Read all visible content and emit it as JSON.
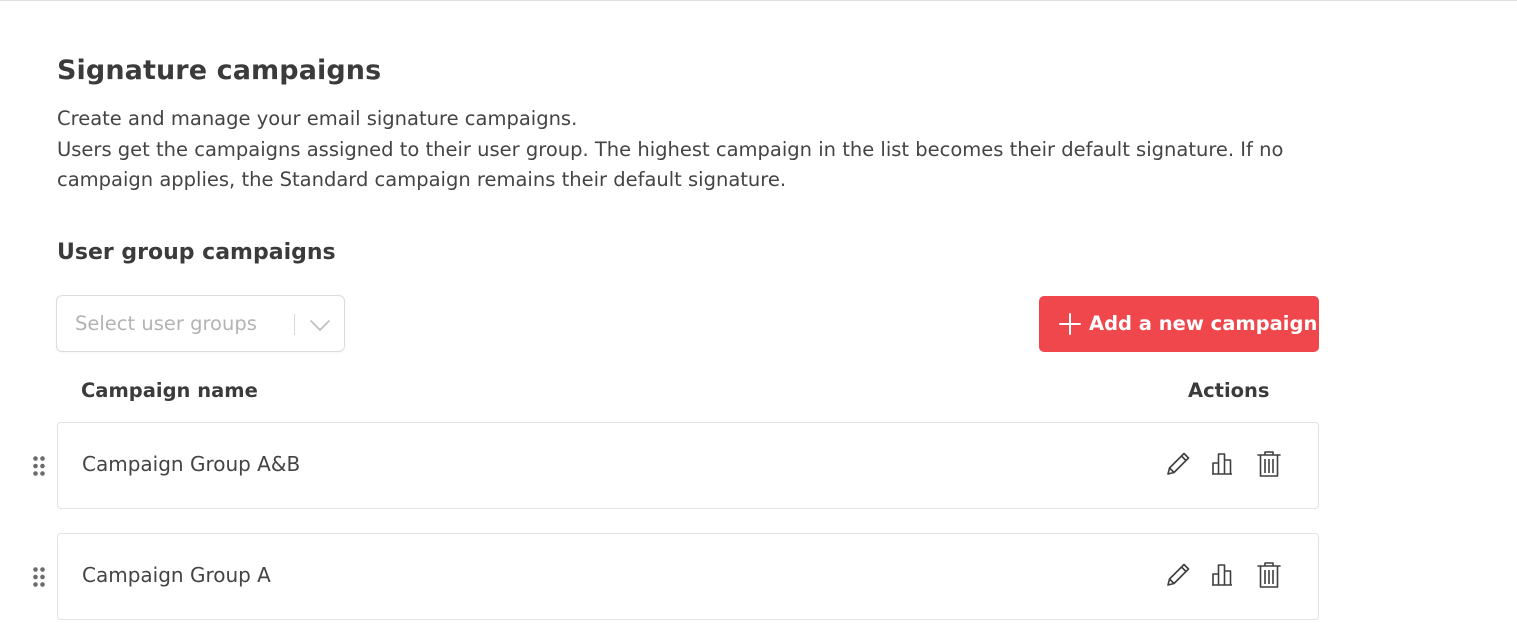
{
  "page": {
    "title": "Signature campaigns",
    "description_lines": [
      "Create and manage your email signature campaigns.",
      "Users get the campaigns assigned to their user group. The highest campaign in the list becomes their default signature. If no campaign applies, the Standard campaign remains their default signature."
    ]
  },
  "section": {
    "title": "User group campaigns"
  },
  "filter": {
    "placeholder": "Select user groups",
    "icon": "chevron-down-icon"
  },
  "add_button": {
    "label": "Add a new campaign",
    "icon": "plus-icon",
    "color": "#f0474d"
  },
  "table": {
    "columns": [
      "Campaign name",
      "Actions"
    ],
    "rows": [
      {
        "name": "Campaign Group A&B",
        "actions": [
          "edit-icon",
          "stats-icon",
          "delete-icon"
        ]
      },
      {
        "name": "Campaign Group A",
        "actions": [
          "edit-icon",
          "stats-icon",
          "delete-icon"
        ]
      }
    ]
  }
}
